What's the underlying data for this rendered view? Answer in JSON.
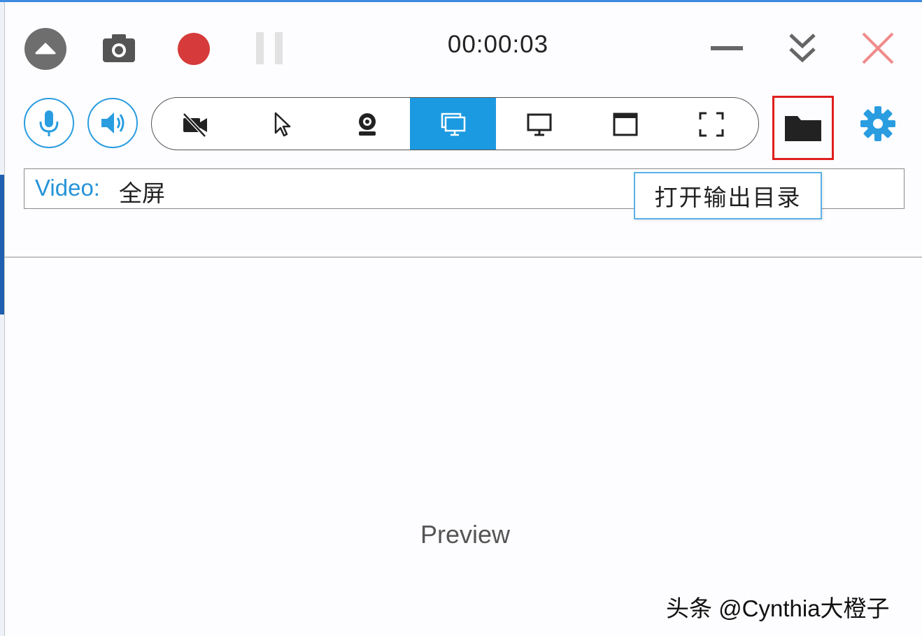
{
  "toolbar": {
    "timer": "00:00:03",
    "collapse_icon": "triangle-up-icon",
    "snapshot_icon": "camera-icon",
    "record_icon": "record-dot-icon",
    "pause_icon": "pause-icon",
    "minimize_icon": "minimize-icon",
    "expand_icon": "double-chevron-down-icon",
    "close_icon": "close-icon"
  },
  "capture_modes": {
    "items": [
      {
        "icon": "no-video-icon",
        "active": false
      },
      {
        "icon": "cursor-icon",
        "active": false
      },
      {
        "icon": "webcam-icon",
        "active": false
      },
      {
        "icon": "screen-icon",
        "active": true
      },
      {
        "icon": "monitor-icon",
        "active": false
      },
      {
        "icon": "window-icon",
        "active": false
      },
      {
        "icon": "region-icon",
        "active": false
      }
    ]
  },
  "audio": {
    "mic_icon": "microphone-icon",
    "speaker_icon": "speaker-icon"
  },
  "output_folder": {
    "icon": "folder-icon",
    "tooltip": "打开输出目录"
  },
  "settings_icon": "gear-icon",
  "video_source": {
    "label": "Video:",
    "value": "全屏"
  },
  "preview": {
    "label": "Preview"
  },
  "watermark": "头条 @Cynthia大橙子",
  "colors": {
    "accent": "#1c9ae1",
    "record": "#d63a3a",
    "close": "#f08a8a",
    "highlight_border": "#e01e1e"
  }
}
